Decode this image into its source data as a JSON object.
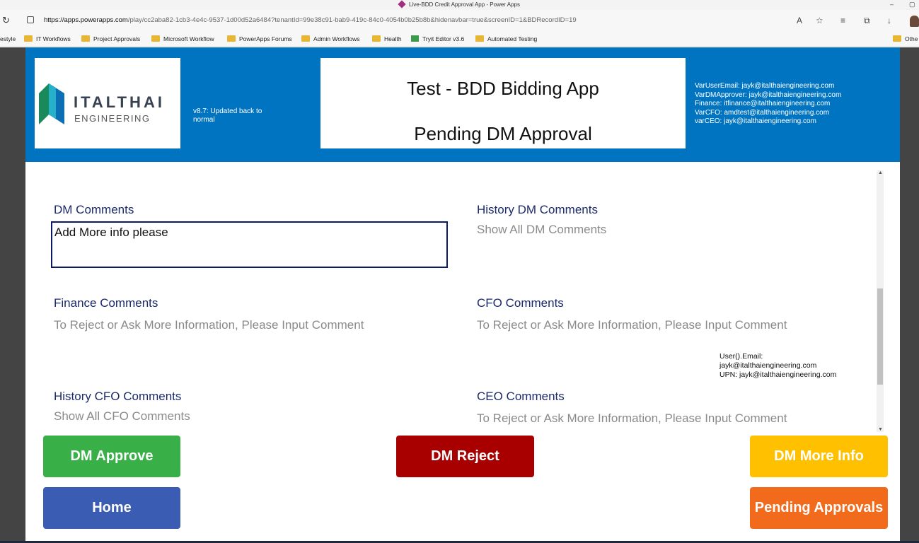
{
  "browser": {
    "window_title": "Live-BDD Credit Approval App - Power Apps",
    "url_host": "https://apps.powerapps.com",
    "url_rest": "/play/cc2aba82-1cb3-4e4c-9537-1d00d52a6484?tenantId=99e38c91-bab9-419c-84c0-4054b0b25b8b&hidenavbar=true&screenID=1&BDRecordID=19",
    "bookmarks": [
      "estyle",
      "IT Workflows",
      "Project Approvals",
      "Microsoft Workflow",
      "PowerApps Forums",
      "Admin Workflows",
      "Health",
      "Tryit Editor v3.6",
      "Automated Testing",
      "Othe"
    ]
  },
  "header": {
    "logo_name": "ITALTHAI",
    "logo_sub": "ENGINEERING",
    "version": "v8.7: Updated back to normal",
    "app_title": "Test - BDD Bidding App",
    "status_title": "Pending DM Approval",
    "vars": [
      "VarUserEmail: jayk@italthaiengineering.com",
      "VarDMApprover: jayk@italthaiengineering.com",
      "Finance: itfinance@italthaiengineering.com",
      "VarCFO: amdtest@italthaiengineering.com",
      "varCEO: jayk@italthaiengineering.com"
    ]
  },
  "form": {
    "dm_comments_label": "DM Comments",
    "dm_comments_value": "Add More info please",
    "history_dm_label": "History DM Comments",
    "history_dm_value": "Show All DM Comments",
    "finance_label": "Finance Comments",
    "finance_placeholder": "To Reject or Ask More Information, Please Input Comment",
    "cfo_label": "CFO Comments",
    "cfo_placeholder": "To Reject or Ask More Information, Please Input Comment",
    "history_cfo_label": "History CFO Comments",
    "history_cfo_value": "Show All CFO Comments",
    "ceo_label": "CEO Comments",
    "ceo_placeholder": "To Reject or Ask More Information, Please Input Comment",
    "user_email_label": "User().Email:",
    "user_email_value": "jayk@italthaiengineering.com",
    "upn": "UPN: jayk@italthaiengineering.com"
  },
  "buttons": {
    "dm_approve": "DM Approve",
    "dm_reject": "DM Reject",
    "dm_more_info": "DM More Info",
    "home": "Home",
    "pending_approvals": "Pending Approvals"
  },
  "colors": {
    "header_blue": "#0074c1",
    "approve_green": "#38b047",
    "reject_red": "#a80000",
    "moreinfo_yellow": "#ffc000",
    "home_blue": "#3a5db3",
    "pending_orange": "#f26a1b",
    "label_navy": "#1a2a6c"
  },
  "icons": [
    "reload-icon",
    "lock-icon",
    "read-aloud-icon",
    "favorite-add-icon",
    "favorites-icon",
    "collections-icon",
    "download-icon",
    "profile-avatar",
    "folder-icon",
    "powerapps-diamond-icon"
  ]
}
